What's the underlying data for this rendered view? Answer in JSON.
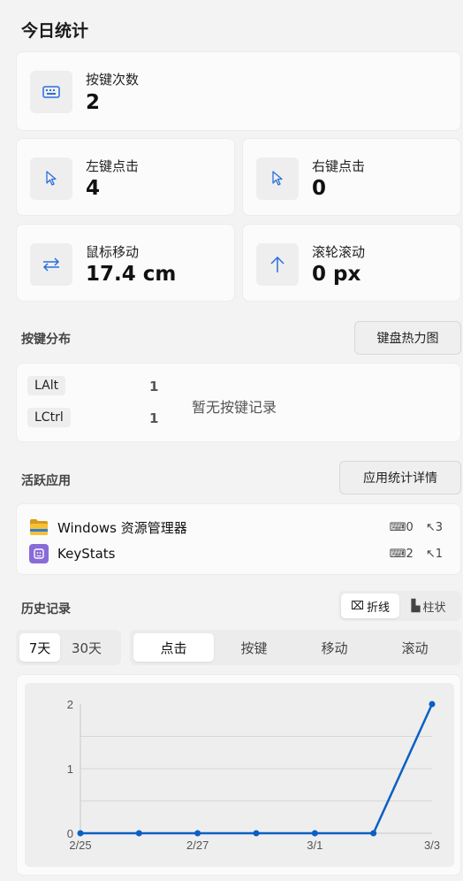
{
  "page_title": "今日统计",
  "stats": {
    "keys": {
      "label": "按键次数",
      "value": "2",
      "icon": "keyboard-icon"
    },
    "left_click": {
      "label": "左键点击",
      "value": "4",
      "icon": "cursor-icon"
    },
    "right_click": {
      "label": "右键点击",
      "value": "0",
      "icon": "cursor-icon"
    },
    "mouse_move": {
      "label": "鼠标移动",
      "value": "17.4 cm",
      "icon": "swap-arrows-icon"
    },
    "scroll": {
      "label": "滚轮滚动",
      "value": "0 px",
      "icon": "arrow-up-icon"
    }
  },
  "key_dist": {
    "title": "按键分布",
    "heatmap_button": "键盘热力图",
    "keys": [
      {
        "name": "LAlt",
        "count": "1"
      },
      {
        "name": "LCtrl",
        "count": "1"
      }
    ],
    "empty_text": "暂无按键记录"
  },
  "active_apps": {
    "title": "活跃应用",
    "detail_button": "应用统计详情",
    "apps": [
      {
        "name": "Windows 资源管理器",
        "keys": "0",
        "clicks": "3",
        "icon": "folder-icon"
      },
      {
        "name": "KeyStats",
        "keys": "2",
        "clicks": "1",
        "icon": "keystats-app-icon"
      }
    ]
  },
  "history": {
    "title": "历史记录",
    "chart_types": [
      {
        "label": "折线",
        "icon": "line-chart-icon",
        "active": true
      },
      {
        "label": "柱状",
        "icon": "bar-chart-icon",
        "active": false
      }
    ],
    "ranges": [
      {
        "label": "7天",
        "active": true
      },
      {
        "label": "30天",
        "active": false
      }
    ],
    "metrics": [
      {
        "label": "点击",
        "active": true
      },
      {
        "label": "按键",
        "active": false
      },
      {
        "label": "移动",
        "active": false
      },
      {
        "label": "滚动",
        "active": false
      }
    ]
  },
  "colors": {
    "accent": "#2a6fdb",
    "line": "#0a5fc4"
  },
  "chart_data": {
    "type": "line",
    "x": [
      "2/25",
      "2/26",
      "2/27",
      "2/28",
      "3/1",
      "3/2",
      "3/3"
    ],
    "x_tick_labels": [
      "2/25",
      "2/27",
      "3/1",
      "3/3"
    ],
    "series": [
      {
        "values": [
          0,
          0,
          0,
          0,
          0,
          0,
          2
        ]
      }
    ],
    "y_ticks": [
      "0",
      "1",
      "2"
    ],
    "ylim": [
      0,
      2
    ],
    "grid": true,
    "title": "",
    "xlabel": "",
    "ylabel": ""
  }
}
